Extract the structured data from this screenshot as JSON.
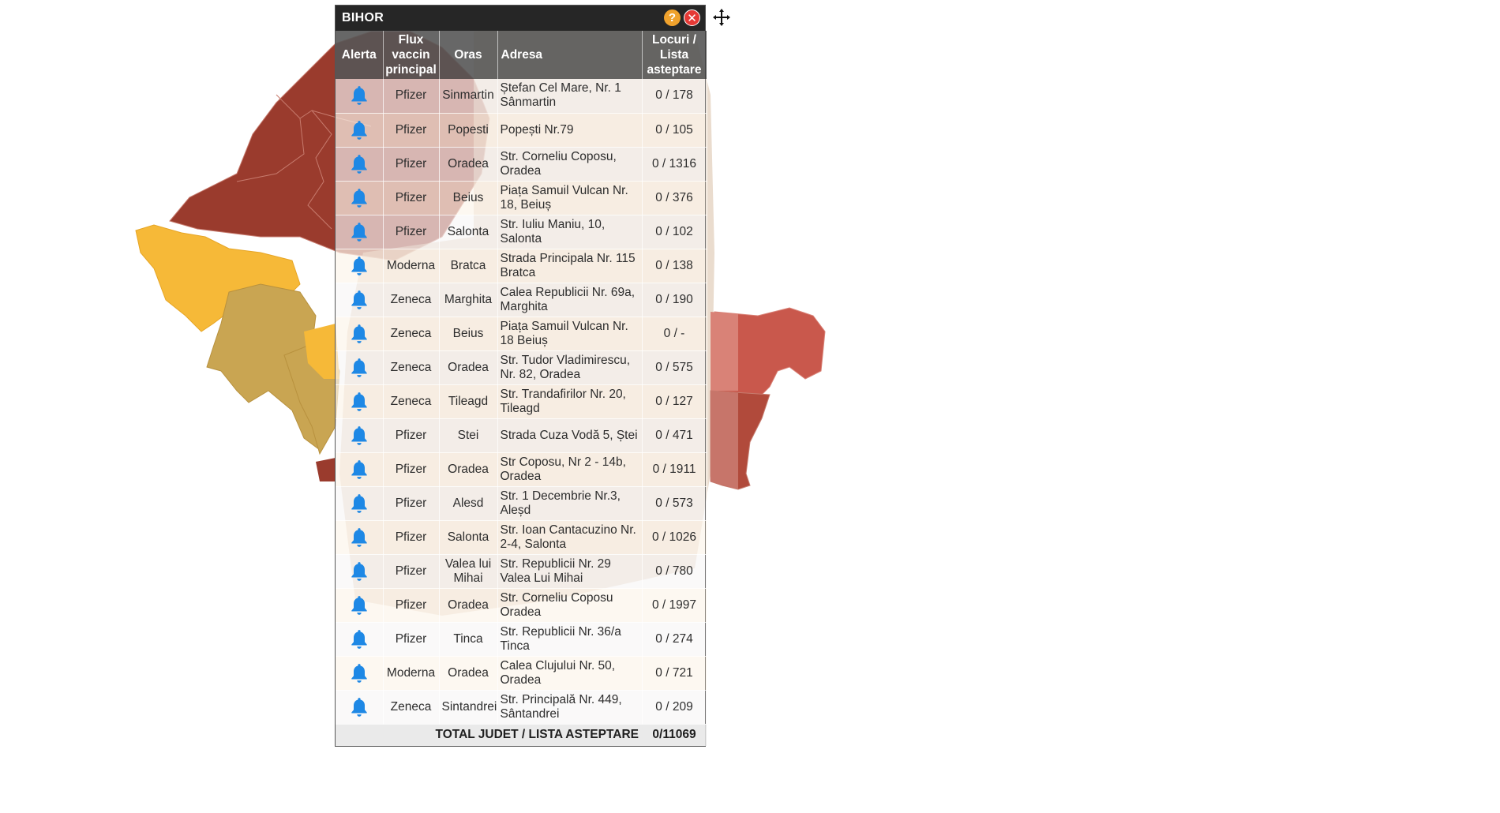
{
  "popup": {
    "title": "BIHOR",
    "help_label": "?",
    "close_label": "✕"
  },
  "colors": {
    "map_dark_red": "#9a3b2d",
    "map_orange": "#f6b938",
    "map_tan": "#c9a552",
    "map_salmon": "#c9584c",
    "bell_blue": "#1e88e5",
    "header_bg": "#262626"
  },
  "table": {
    "headers": {
      "alert": "Alerta",
      "flux": "Flux vaccin principal",
      "city": "Oras",
      "address": "Adresa",
      "places": "Locuri / Lista asteptare"
    },
    "rows": [
      {
        "vaccine": "Pfizer",
        "city": "Sinmartin",
        "address": "Ștefan Cel Mare, Nr. 1 Sânmartin",
        "places": "0 / 178"
      },
      {
        "vaccine": "Pfizer",
        "city": "Popesti",
        "address": "Popești Nr.79",
        "places": "0 / 105"
      },
      {
        "vaccine": "Pfizer",
        "city": "Oradea",
        "address": "Str. Corneliu Coposu, Oradea",
        "places": "0 / 1316"
      },
      {
        "vaccine": "Pfizer",
        "city": "Beius",
        "address": "Piața Samuil Vulcan Nr. 18, Beiuș",
        "places": "0 / 376"
      },
      {
        "vaccine": "Pfizer",
        "city": "Salonta",
        "address": "Str. Iuliu Maniu, 10, Salonta",
        "places": "0 / 102"
      },
      {
        "vaccine": "Moderna",
        "city": "Bratca",
        "address": "Strada Principala Nr. 115 Bratca",
        "places": "0 / 138"
      },
      {
        "vaccine": "Zeneca",
        "city": "Marghita",
        "address": "Calea Republicii Nr. 69a, Marghita",
        "places": "0 / 190"
      },
      {
        "vaccine": "Zeneca",
        "city": "Beius",
        "address": "Piața Samuil Vulcan Nr. 18 Beiuș",
        "places": "0 / -"
      },
      {
        "vaccine": "Zeneca",
        "city": "Oradea",
        "address": "Str. Tudor Vladimirescu, Nr. 82, Oradea",
        "places": "0 / 575"
      },
      {
        "vaccine": "Zeneca",
        "city": "Tileagd",
        "address": "Str. Trandafirilor Nr. 20, Tileagd",
        "places": "0 / 127"
      },
      {
        "vaccine": "Pfizer",
        "city": "Stei",
        "address": "Strada Cuza Vodă 5, Ștei",
        "places": "0 / 471"
      },
      {
        "vaccine": "Pfizer",
        "city": "Oradea",
        "address": "Str Coposu, Nr 2 - 14b, Oradea",
        "places": "0 / 1911"
      },
      {
        "vaccine": "Pfizer",
        "city": "Alesd",
        "address": "Str. 1 Decembrie Nr.3, Aleșd",
        "places": "0 / 573"
      },
      {
        "vaccine": "Pfizer",
        "city": "Salonta",
        "address": "Str. Ioan Cantacuzino Nr. 2-4, Salonta",
        "places": "0 / 1026"
      },
      {
        "vaccine": "Pfizer",
        "city": "Valea lui Mihai",
        "address": "Str. Republicii Nr. 29 Valea Lui Mihai",
        "places": "0 / 780"
      },
      {
        "vaccine": "Pfizer",
        "city": "Oradea",
        "address": "Str. Corneliu Coposu Oradea",
        "places": "0 / 1997"
      },
      {
        "vaccine": "Pfizer",
        "city": "Tinca",
        "address": "Str. Republicii Nr. 36/a Tinca",
        "places": "0 / 274"
      },
      {
        "vaccine": "Moderna",
        "city": "Oradea",
        "address": "Calea Clujului Nr. 50, Oradea",
        "places": "0 / 721"
      },
      {
        "vaccine": "Zeneca",
        "city": "Sintandrei",
        "address": "Str. Principală Nr. 449, Sântandrei",
        "places": "0 / 209"
      }
    ],
    "footer": {
      "label": "TOTAL JUDET / LISTA ASTEPTARE",
      "total": "0/11069"
    }
  },
  "icons": {
    "alert": "bell-icon",
    "move": "move-icon",
    "help": "help-icon",
    "close": "close-icon"
  }
}
